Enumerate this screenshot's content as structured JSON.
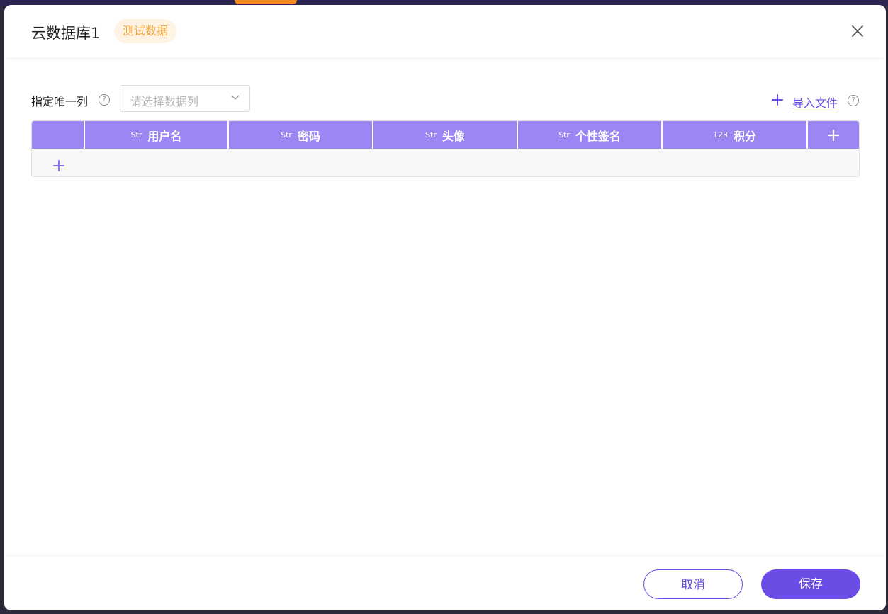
{
  "modal": {
    "title": "云数据库1",
    "tag": "测试数据"
  },
  "toolbar": {
    "unique_column_label": "指定唯一列",
    "help_glyph": "?",
    "select_placeholder": "请选择数据列",
    "import_label": "导入文件"
  },
  "table": {
    "columns": [
      {
        "type": "Str",
        "name": "用户名"
      },
      {
        "type": "Str",
        "name": "密码"
      },
      {
        "type": "Str",
        "name": "头像"
      },
      {
        "type": "Str",
        "name": "个性签名"
      },
      {
        "type": "123",
        "name": "积分"
      }
    ]
  },
  "footer": {
    "cancel_label": "取消",
    "save_label": "保存"
  },
  "colors": {
    "accent": "#6b4de6",
    "header_bg": "#9b86f4",
    "tag_text": "#f3a43b",
    "tag_bg": "#fff4e3"
  }
}
